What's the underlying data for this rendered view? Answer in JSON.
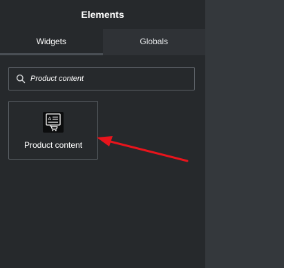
{
  "panel": {
    "title": "Elements",
    "tabs": [
      {
        "label": "Widgets",
        "active": true
      },
      {
        "label": "Globals",
        "active": false
      }
    ]
  },
  "search": {
    "value": "Product content",
    "icon": "search-icon"
  },
  "widgets": [
    {
      "label": "Product content",
      "icon": "product-content-icon"
    }
  ],
  "annotation": {
    "arrow_color": "#e8141c"
  }
}
